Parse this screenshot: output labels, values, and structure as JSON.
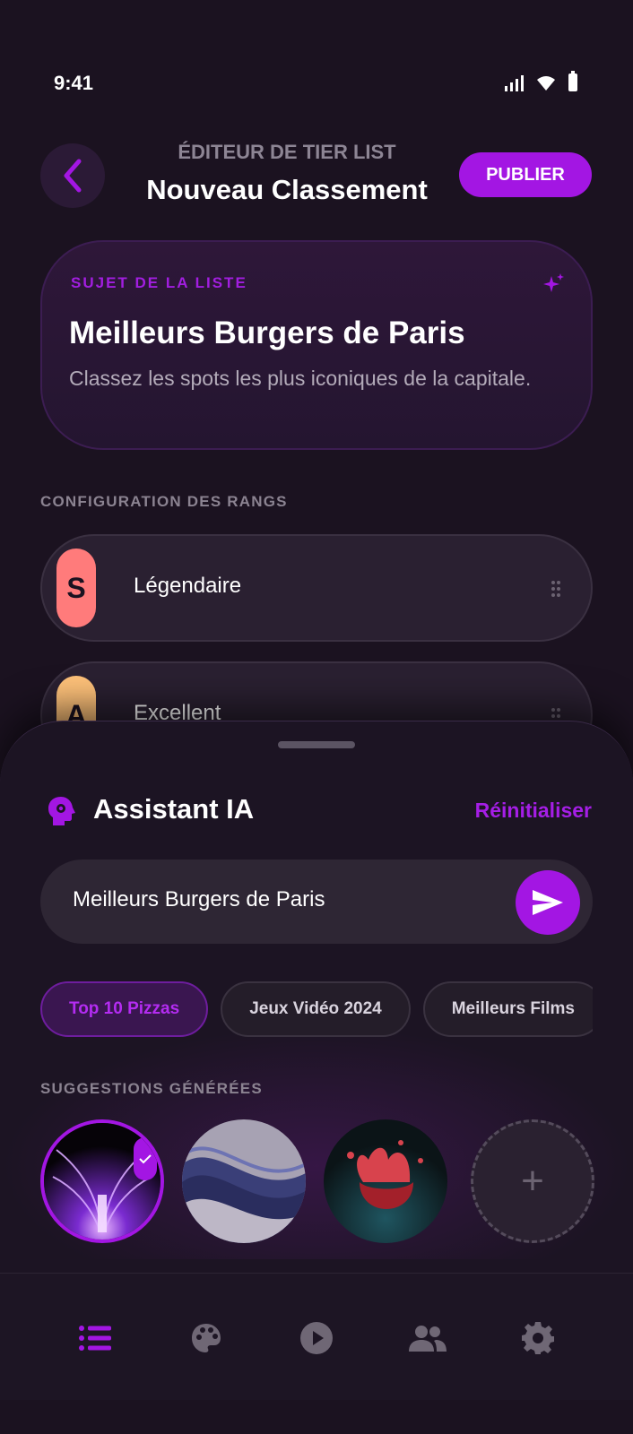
{
  "status_bar": {
    "time": "9:41"
  },
  "header": {
    "subtitle": "ÉDITEUR DE TIER LIST",
    "title": "Nouveau Classement",
    "publish_label": "PUBLIER"
  },
  "subject": {
    "label": "SUJET DE LA LISTE",
    "title": "Meilleurs Burgers de Paris",
    "description": "Classez les spots les plus iconiques de la capitale."
  },
  "tiers_section": {
    "label": "CONFIGURATION DES RANGS",
    "tiers": [
      {
        "letter": "S",
        "name": "Légendaire",
        "color": "#ff7b7b"
      },
      {
        "letter": "A",
        "name": "Excellent",
        "color": "#ffc27a"
      }
    ]
  },
  "assistant": {
    "title": "Assistant IA",
    "reset_label": "Réinitialiser",
    "prompt_value": "Meilleurs Burgers de Paris",
    "chips": [
      "Top 10 Pizzas",
      "Jeux Vidéo 2024",
      "Meilleurs Films"
    ],
    "suggestions_label": "SUGGESTIONS GÉNÉRÉES",
    "add_symbol": "+"
  },
  "nav": {
    "items": [
      "list-icon",
      "palette-icon",
      "play-icon",
      "group-icon",
      "settings-icon"
    ],
    "active_index": 0
  },
  "colors": {
    "accent": "#a316e3",
    "background": "#1b1220",
    "tier_s": "#ff7b7b",
    "tier_a": "#ffc27a"
  }
}
